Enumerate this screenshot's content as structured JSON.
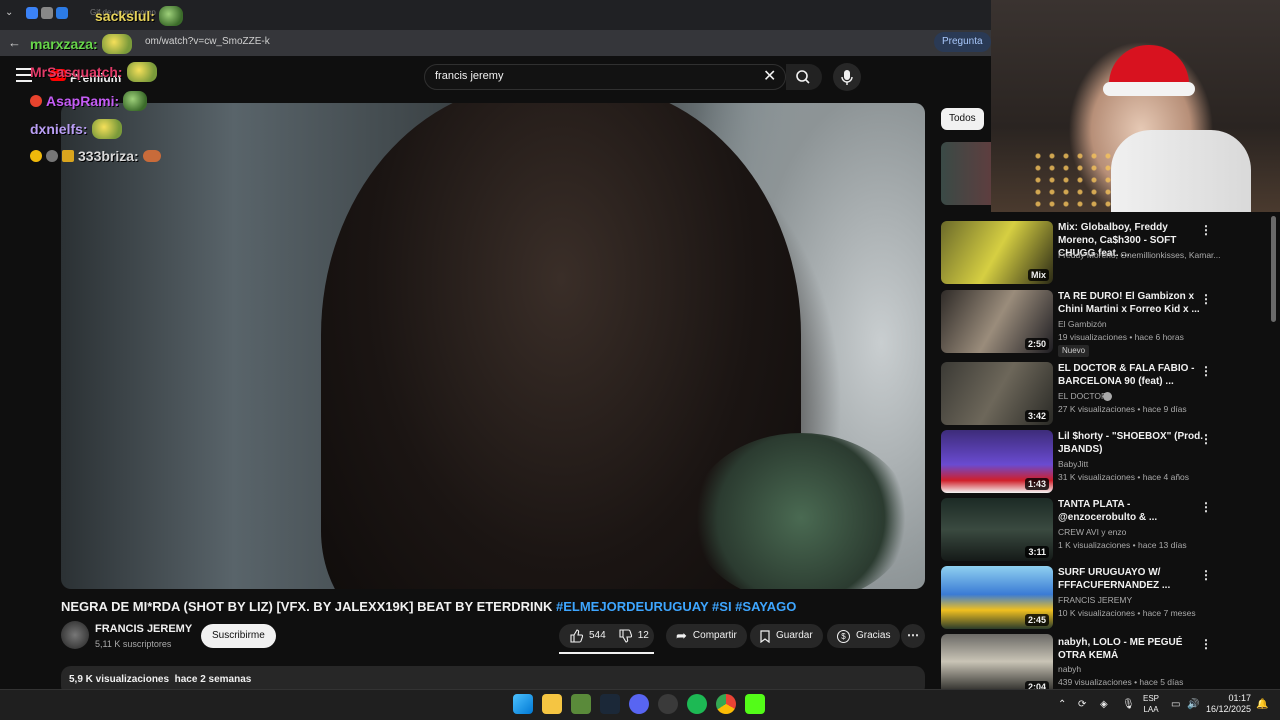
{
  "browser": {
    "url": "om/watch?v=cw_SmoZZE-k",
    "ask_label": "Pregunta",
    "tab_overlap_text": "Gif de negro comp"
  },
  "header": {
    "premium_label": "Premium",
    "search_value": "francis jeremy"
  },
  "chat": [
    {
      "user": "sackslul:",
      "color": "#e7d35a"
    },
    {
      "user": "marxzaza:",
      "color": "#67d64a"
    },
    {
      "user": "MrSasquatch:",
      "color": "#e13b68"
    },
    {
      "user": "AsapRami:",
      "color": "#c55cf5"
    },
    {
      "user": "dxnielfs:",
      "color": "#b99ef4"
    },
    {
      "user": "333briza:",
      "color": "#d8d8d8"
    }
  ],
  "video": {
    "title_main": "NEGRA DE MI*RDA (SHOT BY LIZ) [VFX. BY JALEXX19K] BEAT BY ETERDRINK ",
    "title_tags": "#ELMEJORDEURUGUAY #SI #SAYAGO",
    "channel": "FRANCIS JEREMY",
    "subscribers": "5,11 K suscriptores",
    "subscribe_label": "Suscribirme",
    "likes": "544",
    "dislikes": "12",
    "share_label": "Compartir",
    "save_label": "Guardar",
    "thanks_label": "Gracias",
    "views": "5,9 K visualizaciones",
    "published": "hace 2 semanas"
  },
  "sidebar": {
    "chip_label": "Todos",
    "items": [
      {
        "title": "Mix: Globalboy, Freddy Moreno, Ca$h300 - SOFT CHUGG feat. ...",
        "channel": "Freddy Moreno, Onemillionkisses, Kamar...",
        "meta": "",
        "badge": "Mix"
      },
      {
        "title": "TA RE DURO! El Gambizon x Chini Martini x Forreo Kid x ...",
        "channel": "El Gambizón",
        "meta": "19 visualizaciones • hace 6 horas",
        "badge": "2:50",
        "tag": "Nuevo"
      },
      {
        "title": "EL DOCTOR & FALA FABIO - BARCELONA 90 (feat) ...",
        "channel": "EL DOCTOR",
        "meta": "27 K visualizaciones • hace 9 días",
        "badge": "3:42"
      },
      {
        "title": "Lil $horty - \"SHOEBOX\" (Prod. JBANDS)",
        "channel": "BabyJitt",
        "meta": "31 K visualizaciones • hace 4 años",
        "badge": "1:43"
      },
      {
        "title": "TANTA PLATA - @enzocerobulto & ...",
        "channel": "CREW AVI y enzo",
        "meta": "1 K visualizaciones • hace 13 días",
        "badge": "3:11"
      },
      {
        "title": "SURF URUGUAYO W/ FFFACUFERNANDEZ ...",
        "channel": "FRANCIS JEREMY",
        "meta": "10 K visualizaciones • hace 7 meses",
        "badge": "2:45"
      },
      {
        "title": "nabyh, LOLO - ME PEGUÉ OTRA KEMÁ",
        "channel": "nabyh",
        "meta": "439 visualizaciones • hace 5 días",
        "badge": "2:04"
      }
    ]
  },
  "taskbar": {
    "lang_top": "ESP",
    "lang_bottom": "LAA",
    "time": "01:17",
    "date": "16/12/2025"
  }
}
